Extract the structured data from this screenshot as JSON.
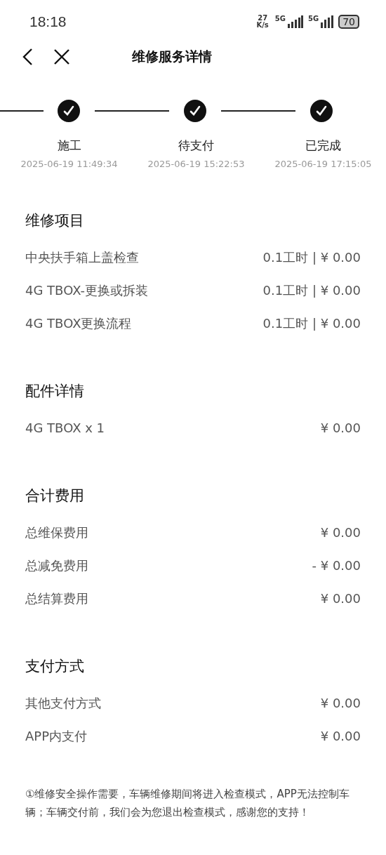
{
  "status_bar": {
    "time": "18:18",
    "net_speed": "27",
    "net_unit": "K/s",
    "sim1": "5G",
    "sim2": "5G",
    "battery": "70"
  },
  "header": {
    "title": "维修服务详情"
  },
  "steps": [
    {
      "label": "施工",
      "time": "2025-06-19 11:49:34",
      "completed": true
    },
    {
      "label": "待支付",
      "time": "2025-06-19 15:22:53",
      "completed": true
    },
    {
      "label": "已完成",
      "time": "2025-06-19 17:15:05",
      "completed": true
    }
  ],
  "sections": [
    {
      "title": "维修项目",
      "rows": [
        {
          "name": "中央扶手箱上盖检查",
          "value": "0.1工时 | ¥ 0.00"
        },
        {
          "name": "4G TBOX-更换或拆装",
          "value": "0.1工时 | ¥ 0.00"
        },
        {
          "name": "4G TBOX更换流程",
          "value": "0.1工时 | ¥ 0.00"
        }
      ]
    },
    {
      "title": "配件详情",
      "rows": [
        {
          "name": "4G TBOX x 1",
          "value": "¥ 0.00"
        }
      ]
    },
    {
      "title": "合计费用",
      "rows": [
        {
          "name": "总维保费用",
          "value": "¥ 0.00"
        },
        {
          "name": "总减免费用",
          "value": "- ¥ 0.00"
        },
        {
          "name": "总结算费用",
          "value": "¥ 0.00"
        }
      ]
    },
    {
      "title": "支付方式",
      "rows": [
        {
          "name": "其他支付方式",
          "value": "¥ 0.00"
        },
        {
          "name": "APP内支付",
          "value": "¥ 0.00"
        }
      ]
    }
  ],
  "note": "①维修安全操作需要，车辆维修期间将进入检查模式，APP无法控制车辆；车辆交付前，我们会为您退出检查模式，感谢您的支持！"
}
